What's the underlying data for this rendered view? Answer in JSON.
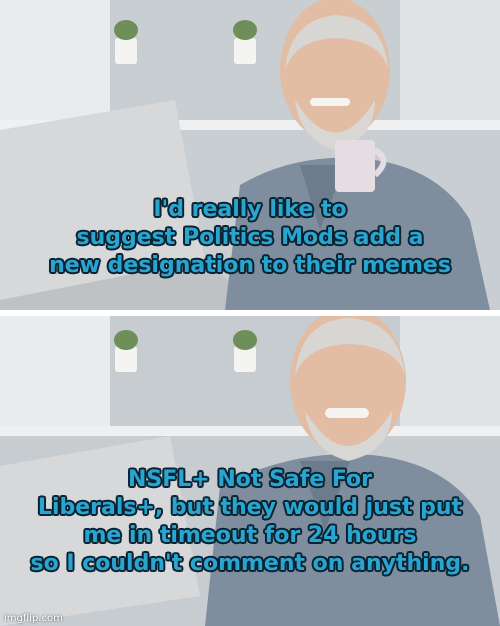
{
  "panels": [
    {
      "caption": "I'd really like to\nsuggest Politics Mods add a\nnew designation to their memes"
    },
    {
      "caption": "NSFL+ Not Safe For\nLiberals+, but they would just put\nme in timeout for 24 hours\nso I couldn't comment on anything."
    }
  ],
  "watermark": "imgflip.com",
  "colors": {
    "caption_fill": "#2aa5d0",
    "caption_outline": "#0b2230"
  }
}
